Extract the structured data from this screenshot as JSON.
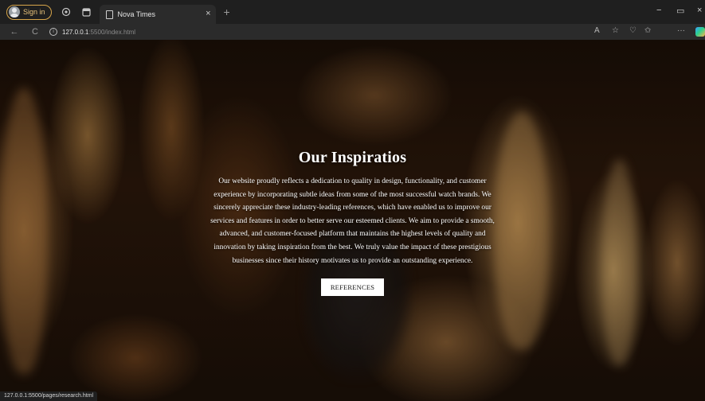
{
  "browser": {
    "signin_label": "Sign in",
    "tab_title": "Nova Times",
    "tab_close": "×",
    "new_tab": "+",
    "url_host": "127.0.0.1",
    "url_path": ":5500/index.html",
    "status_url": "127.0.0.1:5500/pages/research.html",
    "icons": {
      "back": "←",
      "reload": "C",
      "info": "i",
      "minimize": "−",
      "restore": "▭",
      "close": "×",
      "read_aloud": "A",
      "favorite": "☆",
      "collections": "♡",
      "favorites_bar": "✩",
      "more": "···"
    }
  },
  "page": {
    "title": "Our Inspiratios",
    "description": "Our website proudly reflects a dedication to quality in design, functionality, and customer experience by incorporating subtle ideas from some of the most successful watch brands. We sincerely appreciate these industry-leading references, which have enabled us to improve our services and features in order to better serve our esteemed clients. We aim to provide a smooth, advanced, and customer-focused platform that maintains the highest levels of quality and innovation by taking inspiration from the best. We truly value the impact of these prestigious businesses since their history motivates us to provide an outstanding experience.",
    "button_label": "REFERENCES"
  },
  "colors": {
    "signin_border": "#d8a64a",
    "tabbar_bg": "#1f1f1f",
    "addrbar_bg": "#2b2b2b"
  }
}
